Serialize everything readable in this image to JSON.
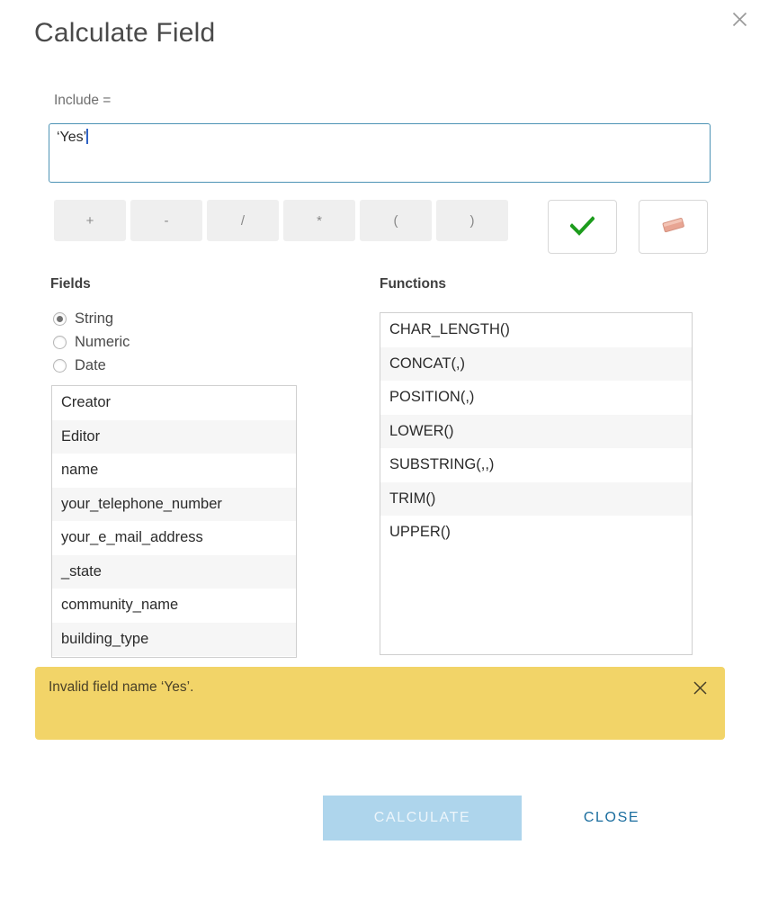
{
  "dialog": {
    "title": "Calculate Field",
    "close_icon": "close-x-icon"
  },
  "expression": {
    "label": "Include =",
    "value": "‘Yes’",
    "placeholder": ""
  },
  "operators": [
    {
      "label": "+",
      "name": "plus"
    },
    {
      "label": "-",
      "name": "minus"
    },
    {
      "label": "/",
      "name": "divide"
    },
    {
      "label": "*",
      "name": "multiply"
    },
    {
      "label": "(",
      "name": "open-paren"
    },
    {
      "label": ")",
      "name": "close-paren"
    }
  ],
  "actions": {
    "validate_icon": "green-check-icon",
    "clear_icon": "eraser-icon"
  },
  "fields": {
    "heading": "Fields",
    "types": [
      {
        "label": "String",
        "selected": true
      },
      {
        "label": "Numeric",
        "selected": false
      },
      {
        "label": "Date",
        "selected": false
      }
    ],
    "items": [
      "Creator",
      "Editor",
      "name",
      "your_telephone_number",
      "your_e_mail_address",
      "_state",
      "community_name",
      "building_type"
    ]
  },
  "functions": {
    "heading": "Functions",
    "items": [
      "CHAR_LENGTH()",
      "CONCAT(,)",
      "POSITION(,)",
      "LOWER()",
      "SUBSTRING(,,)",
      "TRIM()",
      "UPPER()"
    ]
  },
  "banner": {
    "message": "Invalid field name ‘Yes’.",
    "close_icon": "banner-close-x-icon",
    "background": "#f2d468"
  },
  "footer": {
    "calculate_label": "CALCULATE",
    "close_label": "CLOSE",
    "calculate_disabled": true,
    "calculate_color": "#aed5ec",
    "close_color": "#1a6d9e"
  }
}
